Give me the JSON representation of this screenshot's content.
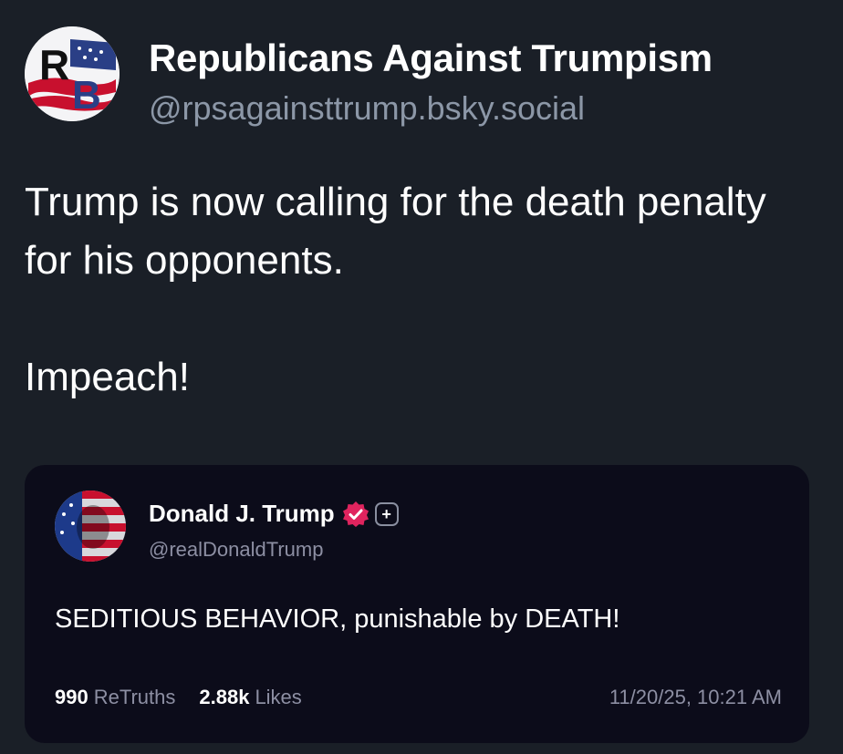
{
  "post": {
    "author": {
      "display_name": "Republicans Against Trumpism",
      "handle": "@rpsagainsttrump.bsky.social",
      "avatar_letters": "RB",
      "avatar_icon": "rb-logo-avatar"
    },
    "text": {
      "line1": "Trump is now calling for the death penalty for his opponents.",
      "line2": "Impeach!"
    }
  },
  "quote": {
    "author": {
      "display_name": "Donald J. Trump",
      "handle": "@realDonaldTrump",
      "avatar_icon": "flag-portrait-avatar",
      "verified_icon": "verified-badge-icon",
      "plus_icon": "plus-badge-icon",
      "plus_symbol": "+"
    },
    "text": "SEDITIOUS BEHAVIOR, punishable by DEATH!",
    "stats": {
      "retruths_count": "990",
      "retruths_label": "ReTruths",
      "likes_count": "2.88k",
      "likes_label": "Likes"
    },
    "timestamp": "11/20/25, 10:21 AM"
  },
  "colors": {
    "background": "#1a1f27",
    "card_background": "#0c0c1a",
    "muted_text": "#8c97a7",
    "verified_badge": "#e0245e"
  }
}
